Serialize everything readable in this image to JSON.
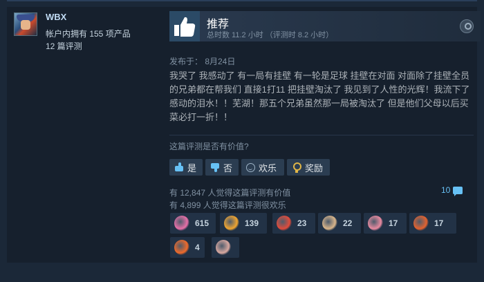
{
  "user": {
    "name": "WBX",
    "products_owned": "帐户内拥有 155 项产品",
    "reviews_count": "12 篇评测"
  },
  "review": {
    "verdict": "推荐",
    "hours": "总时数 11.2 小时 （评测时 8.2 小时）",
    "posted": "发布于：  8月24日",
    "text": "我哭了 我感动了 有一局有挂壁 有一轮是足球 挂壁在对面 对面除了挂壁全员的兄弟都在帮我们 直接1打11 把挂壁淘汰了 我见到了人性的光辉！我流下了感动的泪水！！芜湖！那五个兄弟虽然那一局被淘汰了 但是他们父母以后买菜必打一折！！"
  },
  "helpful": {
    "question": "这篇评测是否有价值?",
    "yes_label": "是",
    "no_label": "否",
    "funny_label": "欢乐",
    "award_label": "奖励",
    "found_helpful": "有 12,847 人觉得这篇评测有价值",
    "found_funny": "有 4,899 人觉得这篇评测很欢乐",
    "comment_count": "10"
  },
  "awards": [
    {
      "icon": "heart-eyes-award-icon",
      "count": "615",
      "color": "#e76fa8"
    },
    {
      "icon": "starstruck-award-icon",
      "count": "139",
      "color": "#f0a530"
    },
    {
      "icon": "rooster-award-icon",
      "count": "23",
      "color": "#e14b3b"
    },
    {
      "icon": "scroll-award-icon",
      "count": "22",
      "color": "#d9b58a"
    },
    {
      "icon": "pig-award-icon",
      "count": "17",
      "color": "#e98aa0"
    },
    {
      "icon": "fish-award-icon",
      "count": "17",
      "color": "#e3622f"
    },
    {
      "icon": "fire-award-icon",
      "count": "4",
      "color": "#ef6a2a"
    },
    {
      "icon": "brain-award-icon",
      "count": "",
      "color": "#d8a8a0"
    }
  ],
  "colors": {
    "accent": "#67c1f5",
    "background": "#1b2838",
    "card": "#16202d"
  }
}
